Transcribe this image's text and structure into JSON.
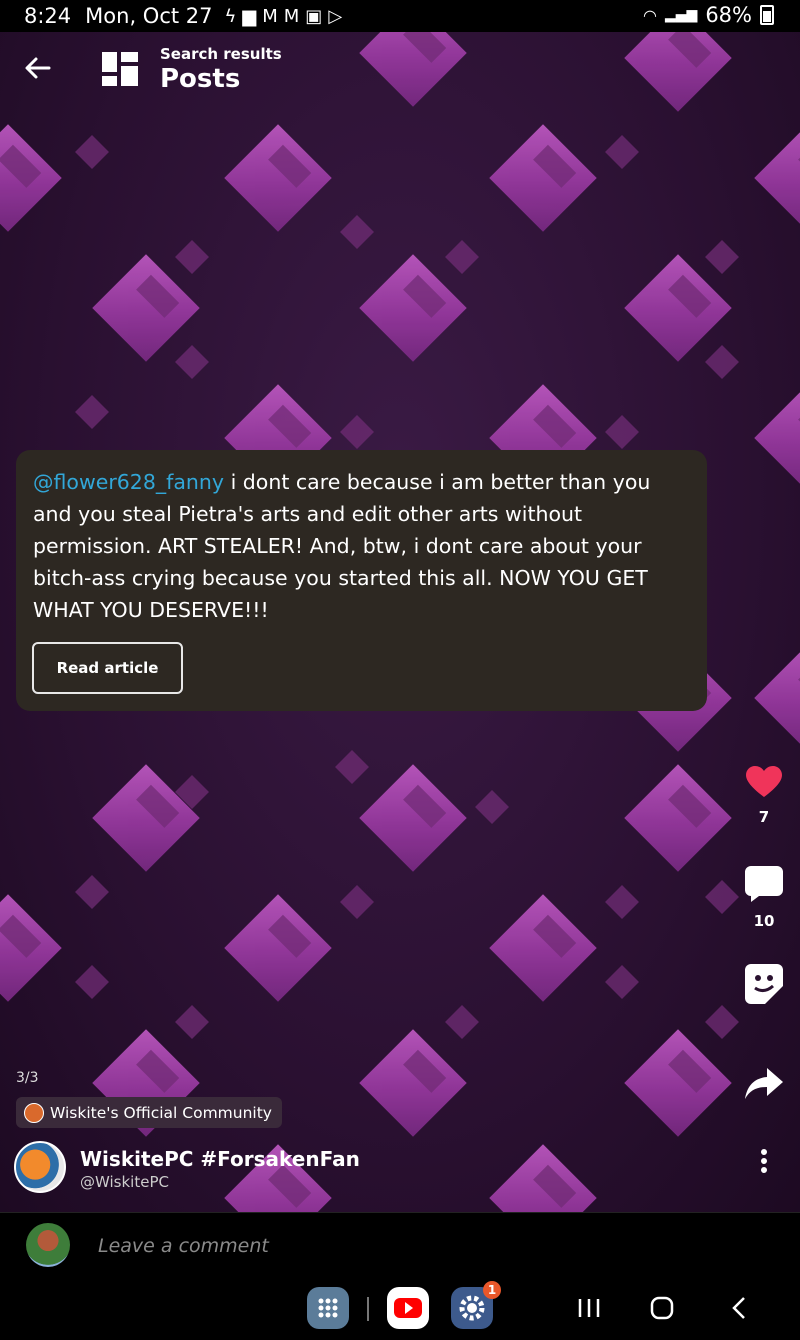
{
  "status_bar": {
    "time": "8:24",
    "date": "Mon, Oct 27",
    "battery": "68%",
    "notification_icons": [
      "flash-icon",
      "folder-icon",
      "gmail-icon",
      "gmail-icon",
      "image-icon",
      "play-icon"
    ]
  },
  "header": {
    "subtitle": "Search results",
    "title": "Posts"
  },
  "post": {
    "mention": "@flower628_fanny",
    "body": " i dont care because i am better than you and you steal Pietra's arts and edit other arts without permission. ART STEALER! And, btw, i dont care about your bitch-ass crying because you started this all. NOW YOU GET WHAT YOU DESERVE!!!",
    "read_button": "Read article",
    "counter": "3/3",
    "community": "Wiskite's Official Community",
    "author_name": "WiskitePC #ForsakenFan",
    "author_handle": "@WiskitePC"
  },
  "actions": {
    "likes": "7",
    "comments": "10"
  },
  "comment_bar": {
    "placeholder": "Leave a comment"
  },
  "nav": {
    "settings_badge": "1"
  },
  "colors": {
    "mention": "#32a7d8",
    "like": "#f0345a",
    "card_bg": "#2d2822",
    "background": "#2a1230"
  }
}
